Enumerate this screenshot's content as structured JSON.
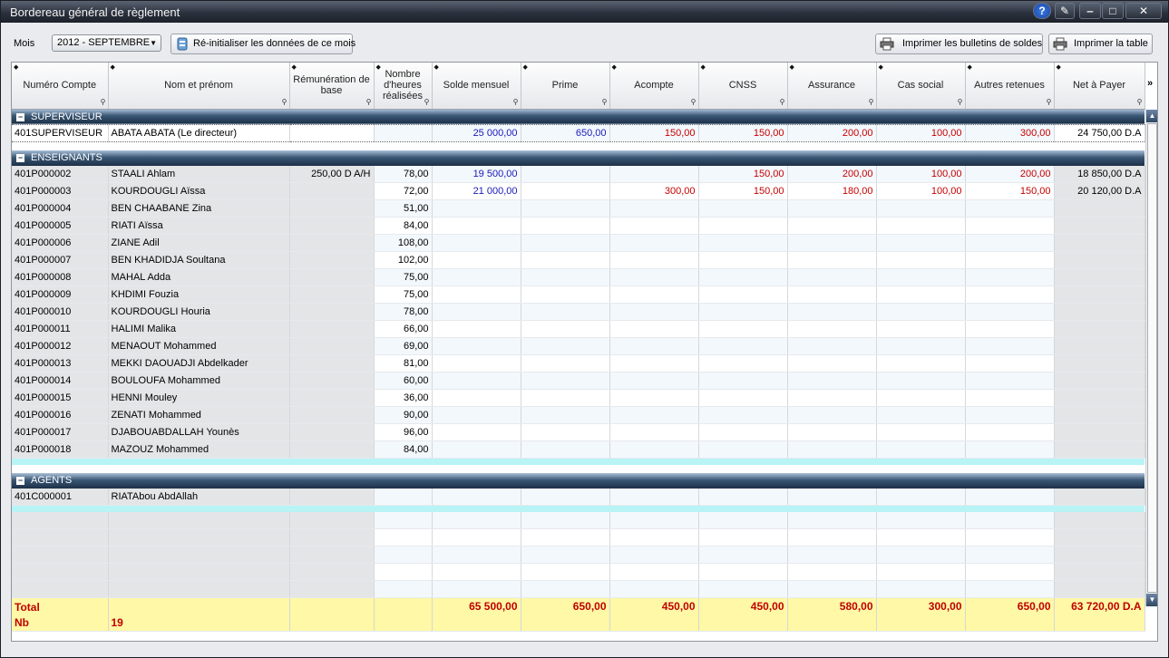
{
  "window": {
    "title": "Bordereau général de règlement"
  },
  "toolbar": {
    "mois_label": "Mois",
    "month_value": "2012 - SEPTEMBRE",
    "reset_label": "Ré-initialiser les données de ce mois",
    "print_bulletins_label": "Imprimer les bulletins de soldes",
    "print_table_label": "Imprimer la table"
  },
  "columns": [
    "Numéro Compte",
    "Nom et prénom",
    "Rémunération de base",
    "Nombre d'heures réalisées",
    "Solde mensuel",
    "Prime",
    "Acompte",
    "CNSS",
    "Assurance",
    "Cas social",
    "Autres retenues",
    "Net à Payer"
  ],
  "groups": [
    {
      "name": "SUPERVISEUR",
      "rows": [
        [
          "401SUPERVISEUR",
          "ABATA ABATA (Le directeur)",
          "",
          "",
          "25 000,00",
          "650,00",
          "150,00",
          "150,00",
          "200,00",
          "100,00",
          "300,00",
          "24 750,00 D.A"
        ]
      ]
    },
    {
      "name": "ENSEIGNANTS",
      "rows": [
        [
          "401P000002",
          "STAALI Ahlam",
          "250,00 D A/H",
          "78,00",
          "19 500,00",
          "",
          "",
          "150,00",
          "200,00",
          "100,00",
          "200,00",
          "18 850,00 D.A"
        ],
        [
          "401P000003",
          "KOURDOUGLI Aïssa",
          "",
          "72,00",
          "21 000,00",
          "",
          "300,00",
          "150,00",
          "180,00",
          "100,00",
          "150,00",
          "20 120,00 D.A"
        ],
        [
          "401P000004",
          "BEN CHAABANE Zina",
          "",
          "51,00",
          "",
          "",
          "",
          "",
          "",
          "",
          "",
          ""
        ],
        [
          "401P000005",
          "RIATI Aïssa",
          "",
          "84,00",
          "",
          "",
          "",
          "",
          "",
          "",
          "",
          ""
        ],
        [
          "401P000006",
          "ZIANE Adil",
          "",
          "108,00",
          "",
          "",
          "",
          "",
          "",
          "",
          "",
          ""
        ],
        [
          "401P000007",
          "BEN KHADIDJA Soultana",
          "",
          "102,00",
          "",
          "",
          "",
          "",
          "",
          "",
          "",
          ""
        ],
        [
          "401P000008",
          "MAHAL Adda",
          "",
          "75,00",
          "",
          "",
          "",
          "",
          "",
          "",
          "",
          ""
        ],
        [
          "401P000009",
          "KHDIMI Fouzia",
          "",
          "75,00",
          "",
          "",
          "",
          "",
          "",
          "",
          "",
          ""
        ],
        [
          "401P000010",
          "KOURDOUGLI Houria",
          "",
          "78,00",
          "",
          "",
          "",
          "",
          "",
          "",
          "",
          ""
        ],
        [
          "401P000011",
          "HALIMI Malika",
          "",
          "66,00",
          "",
          "",
          "",
          "",
          "",
          "",
          "",
          ""
        ],
        [
          "401P000012",
          "MENAOUT Mohammed",
          "",
          "69,00",
          "",
          "",
          "",
          "",
          "",
          "",
          "",
          ""
        ],
        [
          "401P000013",
          "MEKKI DAOUADJI Abdelkader",
          "",
          "81,00",
          "",
          "",
          "",
          "",
          "",
          "",
          "",
          ""
        ],
        [
          "401P000014",
          "BOULOUFA Mohammed",
          "",
          "60,00",
          "",
          "",
          "",
          "",
          "",
          "",
          "",
          ""
        ],
        [
          "401P000015",
          "HENNI Mouley",
          "",
          "36,00",
          "",
          "",
          "",
          "",
          "",
          "",
          "",
          ""
        ],
        [
          "401P000016",
          "ZENATI Mohammed",
          "",
          "90,00",
          "",
          "",
          "",
          "",
          "",
          "",
          "",
          ""
        ],
        [
          "401P000017",
          "DJABOUABDALLAH Younès",
          "",
          "96,00",
          "",
          "",
          "",
          "",
          "",
          "",
          "",
          ""
        ],
        [
          "401P000018",
          "MAZOUZ Mohammed",
          "",
          "84,00",
          "",
          "",
          "",
          "",
          "",
          "",
          "",
          ""
        ]
      ]
    },
    {
      "name": "AGENTS",
      "rows": [
        [
          "401C000001",
          "RIATAbou AbdAllah",
          "",
          "",
          "",
          "",
          "",
          "",
          "",
          "",
          "",
          ""
        ]
      ]
    }
  ],
  "totals": {
    "total_label": "Total",
    "nb_label": "Nb",
    "nb_value": "19",
    "values": [
      "65 500,00",
      "650,00",
      "450,00",
      "450,00",
      "580,00",
      "300,00",
      "650,00",
      "63 720,00 D.A"
    ]
  },
  "colors": {
    "accent_blue": "#1a1ab8",
    "value_red": "#c60000",
    "total_bg": "#fff8a6",
    "group_header": "#1d3048"
  }
}
